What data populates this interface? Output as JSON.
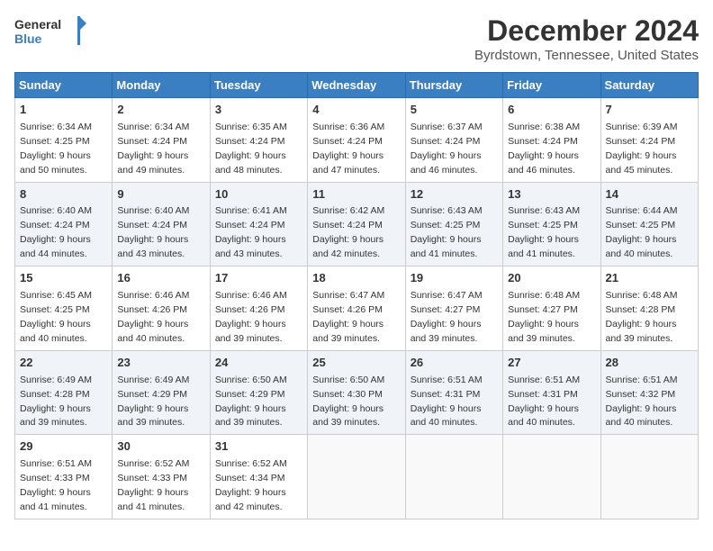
{
  "logo": {
    "line1": "General",
    "line2": "Blue"
  },
  "title": "December 2024",
  "location": "Byrdstown, Tennessee, United States",
  "days_of_week": [
    "Sunday",
    "Monday",
    "Tuesday",
    "Wednesday",
    "Thursday",
    "Friday",
    "Saturday"
  ],
  "weeks": [
    [
      {
        "day": "1",
        "sunrise": "6:34 AM",
        "sunset": "4:25 PM",
        "daylight": "9 hours and 50 minutes."
      },
      {
        "day": "2",
        "sunrise": "6:34 AM",
        "sunset": "4:24 PM",
        "daylight": "9 hours and 49 minutes."
      },
      {
        "day": "3",
        "sunrise": "6:35 AM",
        "sunset": "4:24 PM",
        "daylight": "9 hours and 48 minutes."
      },
      {
        "day": "4",
        "sunrise": "6:36 AM",
        "sunset": "4:24 PM",
        "daylight": "9 hours and 47 minutes."
      },
      {
        "day": "5",
        "sunrise": "6:37 AM",
        "sunset": "4:24 PM",
        "daylight": "9 hours and 46 minutes."
      },
      {
        "day": "6",
        "sunrise": "6:38 AM",
        "sunset": "4:24 PM",
        "daylight": "9 hours and 46 minutes."
      },
      {
        "day": "7",
        "sunrise": "6:39 AM",
        "sunset": "4:24 PM",
        "daylight": "9 hours and 45 minutes."
      }
    ],
    [
      {
        "day": "8",
        "sunrise": "6:40 AM",
        "sunset": "4:24 PM",
        "daylight": "9 hours and 44 minutes."
      },
      {
        "day": "9",
        "sunrise": "6:40 AM",
        "sunset": "4:24 PM",
        "daylight": "9 hours and 43 minutes."
      },
      {
        "day": "10",
        "sunrise": "6:41 AM",
        "sunset": "4:24 PM",
        "daylight": "9 hours and 43 minutes."
      },
      {
        "day": "11",
        "sunrise": "6:42 AM",
        "sunset": "4:24 PM",
        "daylight": "9 hours and 42 minutes."
      },
      {
        "day": "12",
        "sunrise": "6:43 AM",
        "sunset": "4:25 PM",
        "daylight": "9 hours and 41 minutes."
      },
      {
        "day": "13",
        "sunrise": "6:43 AM",
        "sunset": "4:25 PM",
        "daylight": "9 hours and 41 minutes."
      },
      {
        "day": "14",
        "sunrise": "6:44 AM",
        "sunset": "4:25 PM",
        "daylight": "9 hours and 40 minutes."
      }
    ],
    [
      {
        "day": "15",
        "sunrise": "6:45 AM",
        "sunset": "4:25 PM",
        "daylight": "9 hours and 40 minutes."
      },
      {
        "day": "16",
        "sunrise": "6:46 AM",
        "sunset": "4:26 PM",
        "daylight": "9 hours and 40 minutes."
      },
      {
        "day": "17",
        "sunrise": "6:46 AM",
        "sunset": "4:26 PM",
        "daylight": "9 hours and 39 minutes."
      },
      {
        "day": "18",
        "sunrise": "6:47 AM",
        "sunset": "4:26 PM",
        "daylight": "9 hours and 39 minutes."
      },
      {
        "day": "19",
        "sunrise": "6:47 AM",
        "sunset": "4:27 PM",
        "daylight": "9 hours and 39 minutes."
      },
      {
        "day": "20",
        "sunrise": "6:48 AM",
        "sunset": "4:27 PM",
        "daylight": "9 hours and 39 minutes."
      },
      {
        "day": "21",
        "sunrise": "6:48 AM",
        "sunset": "4:28 PM",
        "daylight": "9 hours and 39 minutes."
      }
    ],
    [
      {
        "day": "22",
        "sunrise": "6:49 AM",
        "sunset": "4:28 PM",
        "daylight": "9 hours and 39 minutes."
      },
      {
        "day": "23",
        "sunrise": "6:49 AM",
        "sunset": "4:29 PM",
        "daylight": "9 hours and 39 minutes."
      },
      {
        "day": "24",
        "sunrise": "6:50 AM",
        "sunset": "4:29 PM",
        "daylight": "9 hours and 39 minutes."
      },
      {
        "day": "25",
        "sunrise": "6:50 AM",
        "sunset": "4:30 PM",
        "daylight": "9 hours and 39 minutes."
      },
      {
        "day": "26",
        "sunrise": "6:51 AM",
        "sunset": "4:31 PM",
        "daylight": "9 hours and 40 minutes."
      },
      {
        "day": "27",
        "sunrise": "6:51 AM",
        "sunset": "4:31 PM",
        "daylight": "9 hours and 40 minutes."
      },
      {
        "day": "28",
        "sunrise": "6:51 AM",
        "sunset": "4:32 PM",
        "daylight": "9 hours and 40 minutes."
      }
    ],
    [
      {
        "day": "29",
        "sunrise": "6:51 AM",
        "sunset": "4:33 PM",
        "daylight": "9 hours and 41 minutes."
      },
      {
        "day": "30",
        "sunrise": "6:52 AM",
        "sunset": "4:33 PM",
        "daylight": "9 hours and 41 minutes."
      },
      {
        "day": "31",
        "sunrise": "6:52 AM",
        "sunset": "4:34 PM",
        "daylight": "9 hours and 42 minutes."
      },
      null,
      null,
      null,
      null
    ]
  ],
  "labels": {
    "sunrise": "Sunrise:",
    "sunset": "Sunset:",
    "daylight": "Daylight:"
  }
}
